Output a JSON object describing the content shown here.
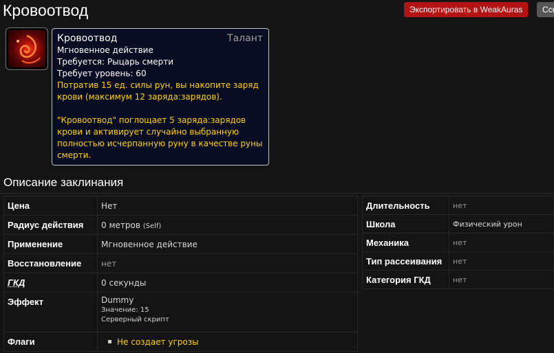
{
  "page": {
    "title": "Кровоотвод",
    "export_button": "Экспортировать в WeakAuras",
    "link_button": "Ссылка"
  },
  "icon": {
    "name": "blood-tap-spell-icon"
  },
  "tooltip": {
    "name": "Кровоотвод",
    "type": "Талант",
    "cast": "Мгновенное действие",
    "requires_class": "Требуется: Рыцарь смерти",
    "requires_level": "Требует уровень: 60",
    "desc1_line1": "Потратив 15 ед. силы рун, вы накопите заряд",
    "desc1_line2": "крови (максимум 12 заряда:зарядов).",
    "desc2_line1": "\"Кровоотвод\" поглощает 5 заряда:зарядов",
    "desc2_line2": "крови и активирует случайно выбранную",
    "desc2_line3": "полностью исчерпанную руну в качестве руны",
    "desc2_line4": "смерти.",
    "colors": {
      "background": "#080c22",
      "highlight": "#ffd100"
    }
  },
  "spell_details": {
    "section_title": "Описание заклинания",
    "left": {
      "cost_label": "Цена",
      "cost_value": "Нет",
      "range_label": "Радиус действия",
      "range_value": "0 метров",
      "range_note": "(Self)",
      "cast_label": "Применение",
      "cast_value": "Мгновенное действие",
      "cooldown_label": "Восстановление",
      "cooldown_value": "нет",
      "gcd_label": "ГКД",
      "gcd_value": "0 секунды",
      "effect_label": "Эффект",
      "effect_name": "Dummy",
      "effect_value": "Значение: 15",
      "effect_script": "Серверный скрипт",
      "flags_label": "Флаги",
      "flags": [
        "Не создает угрозы"
      ]
    },
    "right": {
      "duration_label": "Длительность",
      "duration_value": "нет",
      "school_label": "Школа",
      "school_value": "Физический урон",
      "mechanic_label": "Механика",
      "mechanic_value": "нет",
      "dispel_label": "Тип рассеивания",
      "dispel_value": "нет",
      "gcd_category_label": "Категория ГКД",
      "gcd_category_value": "нет"
    }
  }
}
